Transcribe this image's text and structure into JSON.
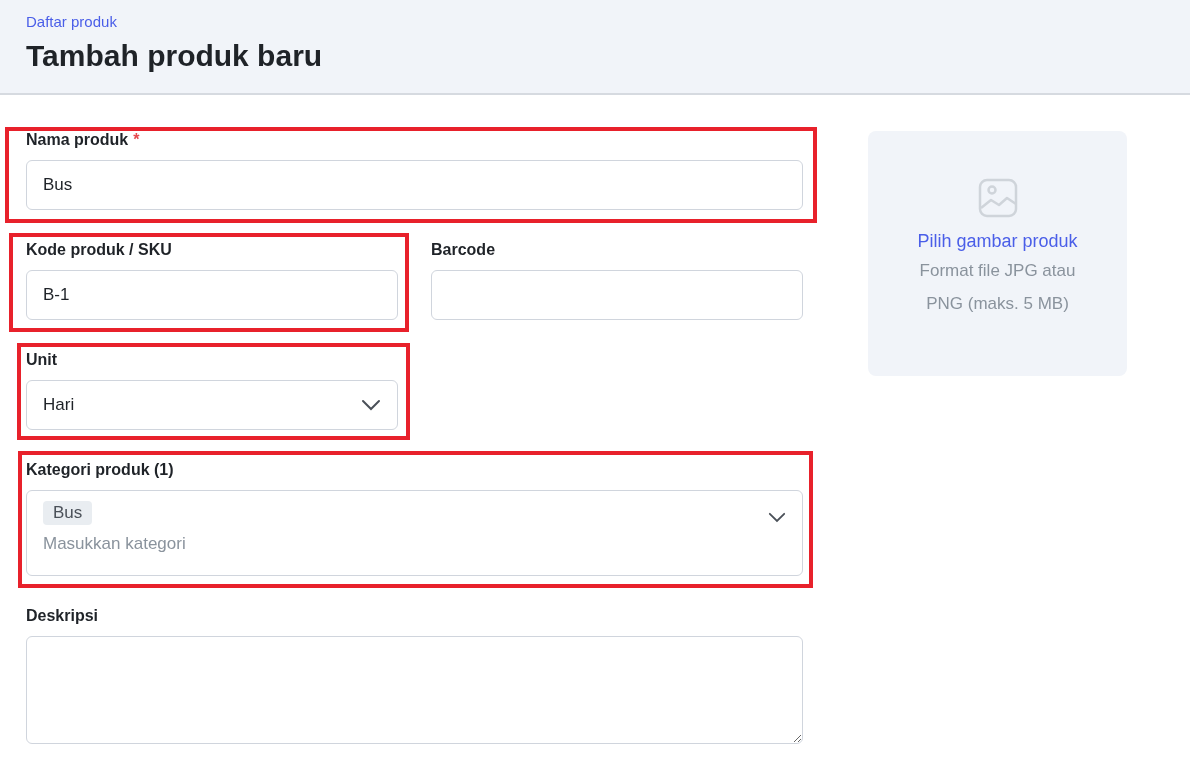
{
  "breadcrumb": "Daftar produk",
  "title": "Tambah produk baru",
  "name_field": {
    "label": "Nama produk",
    "required_mark": "*",
    "value": "Bus",
    "highlighted": true
  },
  "sku_field": {
    "label": "Kode produk / SKU",
    "value": "B-1",
    "highlighted": true
  },
  "barcode_field": {
    "label": "Barcode",
    "highlighted": false
  },
  "unit_field": {
    "label": "Unit",
    "value": "Hari",
    "highlighted": true
  },
  "category_field": {
    "label": "Kategori produk (1)",
    "tags": [
      "Bus"
    ],
    "placeholder": "Masukkan kategori",
    "highlighted": true
  },
  "description_field": {
    "label": "Deskripsi",
    "highlighted": false
  },
  "image_upload": {
    "link": "Pilih gambar produk",
    "hint": "Format file JPG atau PNG (maks. 5 MB)"
  }
}
